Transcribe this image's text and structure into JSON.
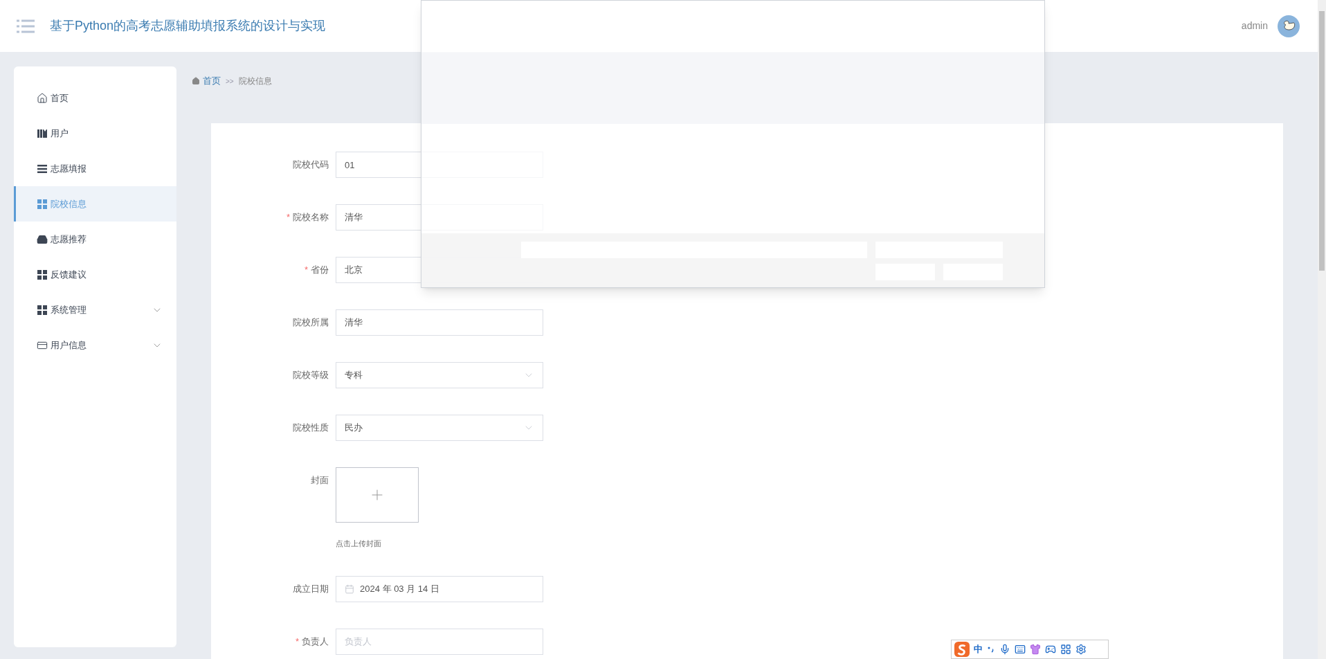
{
  "header": {
    "title": "基于Python的高考志愿辅助填报系统的设计与实现",
    "user": "admin"
  },
  "sidebar": {
    "items": [
      {
        "label": "首页",
        "selected": false,
        "expandable": false
      },
      {
        "label": "用户",
        "selected": false,
        "expandable": false
      },
      {
        "label": "志愿填报",
        "selected": false,
        "expandable": false
      },
      {
        "label": "院校信息",
        "selected": true,
        "expandable": false
      },
      {
        "label": "志愿推荐",
        "selected": false,
        "expandable": false
      },
      {
        "label": "反馈建议",
        "selected": false,
        "expandable": false
      },
      {
        "label": "系统管理",
        "selected": false,
        "expandable": true
      },
      {
        "label": "用户信息",
        "selected": false,
        "expandable": true
      }
    ]
  },
  "breadcrumb": {
    "home": "首页",
    "separator": ">>",
    "current": "院校信息"
  },
  "form": {
    "fields": [
      {
        "kind": "text",
        "label": "院校代码",
        "value": "01"
      },
      {
        "kind": "text",
        "label": "院校名称",
        "mark": "*",
        "value": "清华"
      },
      {
        "kind": "text",
        "label": "省份",
        "mark": "*",
        "value": "北京"
      },
      {
        "kind": "text",
        "label": "院校所属",
        "value": "清华"
      },
      {
        "kind": "select",
        "label": "院校等级",
        "value": "专科"
      },
      {
        "kind": "select",
        "label": "院校性质",
        "value": "民办"
      },
      {
        "kind": "upload",
        "label": "封面",
        "hint": "点击上传封面"
      },
      {
        "kind": "date",
        "label": "成立日期",
        "value": "2024 年 03 月 14 日"
      },
      {
        "kind": "text",
        "label": "负责人",
        "mark": "*",
        "placeholder": "负责人"
      }
    ]
  },
  "ime_toolbar": {
    "mode": "中"
  }
}
